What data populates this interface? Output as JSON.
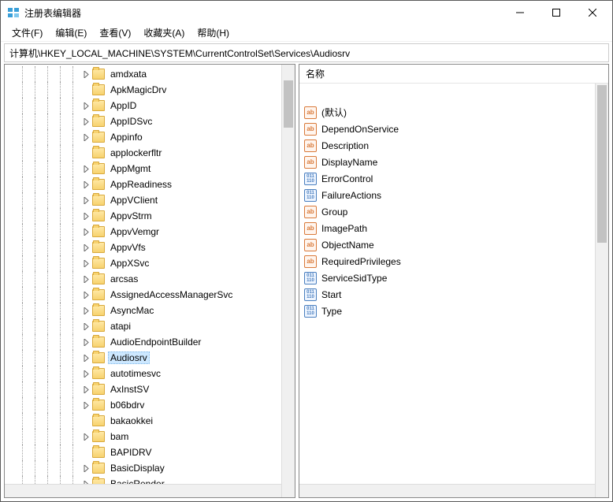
{
  "window": {
    "title": "注册表编辑器"
  },
  "menu": {
    "file": "文件(F)",
    "edit": "编辑(E)",
    "view": "查看(V)",
    "favorites": "收藏夹(A)",
    "help": "帮助(H)"
  },
  "addressbar": {
    "path": "计算机\\HKEY_LOCAL_MACHINE\\SYSTEM\\CurrentControlSet\\Services\\Audiosrv"
  },
  "tree": {
    "items": [
      {
        "label": "amdxata",
        "expandable": true
      },
      {
        "label": "ApkMagicDrv",
        "expandable": false
      },
      {
        "label": "AppID",
        "expandable": true
      },
      {
        "label": "AppIDSvc",
        "expandable": true
      },
      {
        "label": "Appinfo",
        "expandable": true
      },
      {
        "label": "applockerfltr",
        "expandable": false
      },
      {
        "label": "AppMgmt",
        "expandable": true
      },
      {
        "label": "AppReadiness",
        "expandable": true
      },
      {
        "label": "AppVClient",
        "expandable": true
      },
      {
        "label": "AppvStrm",
        "expandable": true
      },
      {
        "label": "AppvVemgr",
        "expandable": true
      },
      {
        "label": "AppvVfs",
        "expandable": true
      },
      {
        "label": "AppXSvc",
        "expandable": true
      },
      {
        "label": "arcsas",
        "expandable": true
      },
      {
        "label": "AssignedAccessManagerSvc",
        "expandable": true
      },
      {
        "label": "AsyncMac",
        "expandable": true
      },
      {
        "label": "atapi",
        "expandable": true
      },
      {
        "label": "AudioEndpointBuilder",
        "expandable": true
      },
      {
        "label": "Audiosrv",
        "expandable": true,
        "selected": true
      },
      {
        "label": "autotimesvc",
        "expandable": true
      },
      {
        "label": "AxInstSV",
        "expandable": true
      },
      {
        "label": "b06bdrv",
        "expandable": true
      },
      {
        "label": "bakaokkei",
        "expandable": false
      },
      {
        "label": "bam",
        "expandable": true
      },
      {
        "label": "BAPIDRV",
        "expandable": false
      },
      {
        "label": "BasicDisplay",
        "expandable": true
      },
      {
        "label": "BasicRender",
        "expandable": true
      }
    ]
  },
  "list": {
    "header": "名称",
    "values": [
      {
        "name": "(默认)",
        "type": "str"
      },
      {
        "name": "DependOnService",
        "type": "str"
      },
      {
        "name": "Description",
        "type": "str"
      },
      {
        "name": "DisplayName",
        "type": "str"
      },
      {
        "name": "ErrorControl",
        "type": "bin"
      },
      {
        "name": "FailureActions",
        "type": "bin"
      },
      {
        "name": "Group",
        "type": "str"
      },
      {
        "name": "ImagePath",
        "type": "str"
      },
      {
        "name": "ObjectName",
        "type": "str"
      },
      {
        "name": "RequiredPrivileges",
        "type": "str"
      },
      {
        "name": "ServiceSidType",
        "type": "bin"
      },
      {
        "name": "Start",
        "type": "bin"
      },
      {
        "name": "Type",
        "type": "bin"
      }
    ]
  },
  "icon_text": {
    "str": "ab",
    "bin": "011\n110"
  }
}
